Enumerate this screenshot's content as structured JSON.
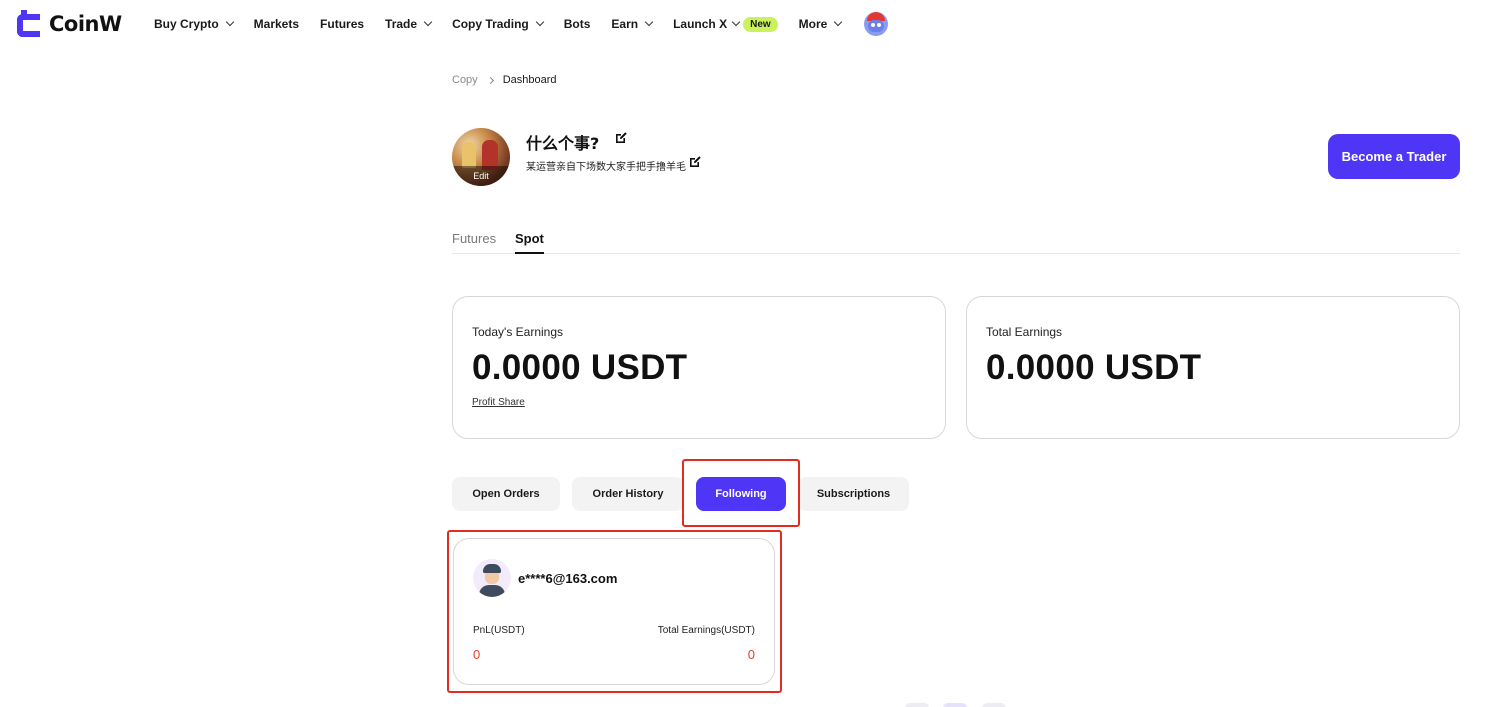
{
  "nav": {
    "brand": "CoinW",
    "items": [
      {
        "label": "Buy Crypto",
        "dropdown": true
      },
      {
        "label": "Markets",
        "dropdown": false
      },
      {
        "label": "Futures",
        "dropdown": false
      },
      {
        "label": "Trade",
        "dropdown": true
      },
      {
        "label": "Copy Trading",
        "dropdown": true
      },
      {
        "label": "Bots",
        "dropdown": false
      },
      {
        "label": "Earn",
        "dropdown": true
      },
      {
        "label": "Launch X",
        "dropdown": true,
        "badge": "New"
      },
      {
        "label": "More",
        "dropdown": true
      }
    ]
  },
  "breadcrumb": {
    "root": "Copy",
    "current": "Dashboard"
  },
  "profile": {
    "name": "什么个事?",
    "bio": "某运营亲自下场数大家手把手撸羊毛",
    "avatar_edit_label": "Edit",
    "become_trader_label": "Become a Trader"
  },
  "tabs": {
    "futures": "Futures",
    "spot": "Spot",
    "active": "Spot"
  },
  "earnings": {
    "today": {
      "label": "Today's Earnings",
      "value": "0.0000 USDT",
      "link": "Profit Share"
    },
    "total": {
      "label": "Total Earnings",
      "value": "0.0000 USDT"
    }
  },
  "subtabs": {
    "open_orders": "Open Orders",
    "order_history": "Order History",
    "following": "Following",
    "subscriptions": "Subscriptions",
    "active": "Following"
  },
  "following": [
    {
      "name": "e****6@163.com",
      "pnl_label": "PnL(USDT)",
      "pnl_value": "0",
      "total_label": "Total Earnings(USDT)",
      "total_value": "0"
    }
  ],
  "colors": {
    "brand": "#4f35f5",
    "highlight": "#e02d1f",
    "negative": "#e8412b",
    "badge": "#c9f25c"
  }
}
